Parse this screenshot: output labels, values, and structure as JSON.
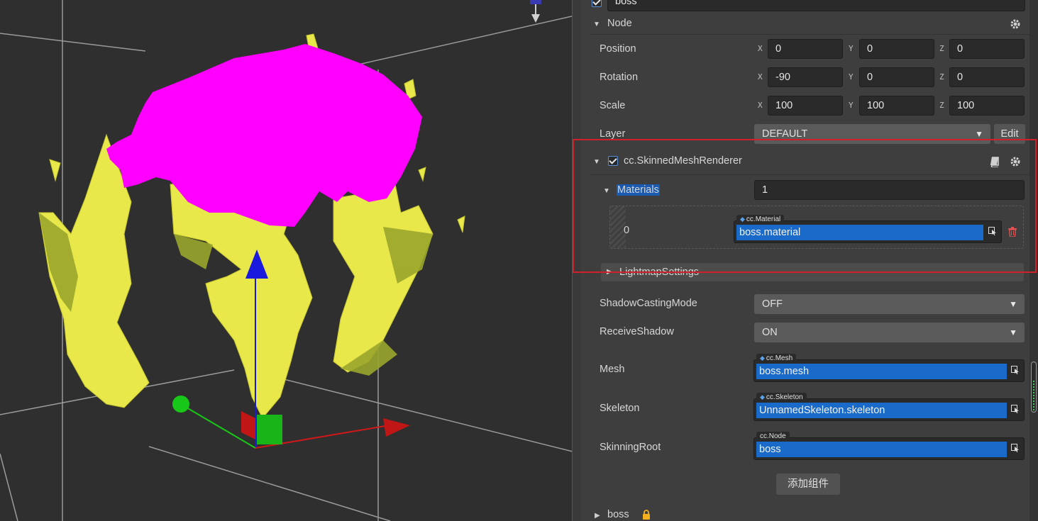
{
  "colors": {
    "accent": "#1a6bc9",
    "highlight_box": "#d0202a",
    "mesh_magenta": "#ff00ff",
    "mesh_yellow": "#e8e84a",
    "gizmo_x": "#d01818",
    "gizmo_y": "#1a1adc",
    "gizmo_z": "#18c818"
  },
  "scene": {
    "gizmo_icons": [
      "translate-gizmo-x-arrow",
      "translate-gizmo-y-arrow",
      "translate-gizmo-z-handle"
    ]
  },
  "inspector": {
    "node_name": "boss",
    "node_section": {
      "title": "Node",
      "position": {
        "label": "Position",
        "x": "0",
        "y": "0",
        "z": "0"
      },
      "rotation": {
        "label": "Rotation",
        "x": "-90",
        "y": "0",
        "z": "0"
      },
      "scale": {
        "label": "Scale",
        "x": "100",
        "y": "100",
        "z": "100"
      },
      "layer": {
        "label": "Layer",
        "value": "DEFAULT",
        "edit_label": "Edit"
      }
    },
    "axis_labels": {
      "x": "X",
      "y": "Y",
      "z": "Z"
    },
    "component": {
      "title": "cc.SkinnedMeshRenderer",
      "materials": {
        "label": "Materials",
        "count": "1",
        "items": [
          {
            "index": "0",
            "type": "cc.Material",
            "value": "boss.material"
          }
        ]
      },
      "lightmap_settings": "LightmapSettings",
      "shadow_casting": {
        "label": "ShadowCastingMode",
        "value": "OFF"
      },
      "receive_shadow": {
        "label": "ReceiveShadow",
        "value": "ON"
      },
      "mesh": {
        "label": "Mesh",
        "type": "cc.Mesh",
        "value": "boss.mesh"
      },
      "skeleton": {
        "label": "Skeleton",
        "type": "cc.Skeleton",
        "value": "UnnamedSkeleton.skeleton"
      },
      "skinning_root": {
        "label": "SkinningRoot",
        "type": "cc.Node",
        "value": "boss"
      }
    },
    "add_component_label": "添加组件",
    "child_node": "boss"
  }
}
